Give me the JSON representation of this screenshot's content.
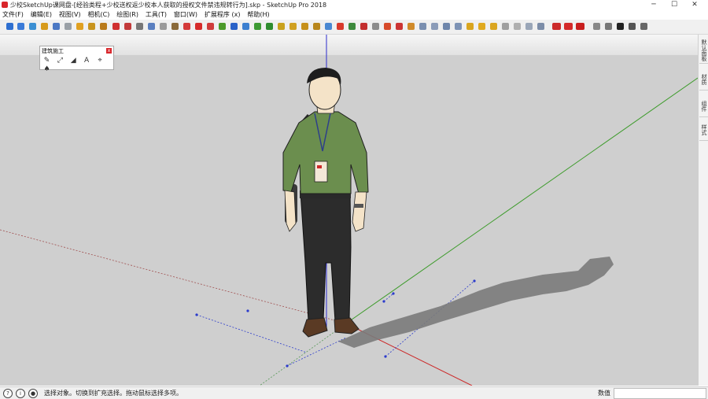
{
  "titlebar": {
    "title": "少校SketchUp课网盘-[经验类程+少校送权返少校本人获取的授权文件禁违规转行为].skp - SketchUp Pro 2018",
    "minimize": "─",
    "maximize": "☐",
    "close": "✕"
  },
  "menu": [
    "文件(F)",
    "编辑(E)",
    "视图(V)",
    "相机(C)",
    "绘图(R)",
    "工具(T)",
    "窗口(W)",
    "扩展程序 (x)",
    "帮助(H)"
  ],
  "floating_toolbar": {
    "title": "建筑施工",
    "close": "x"
  },
  "tray_tabs": [
    "默认面板",
    "材质",
    "组件",
    "样式"
  ],
  "statusbar": {
    "hint": "选择对象。切换到扩充选择。拖动鼠标选择多项。",
    "measurements_label": "数值",
    "measurements_value": ""
  },
  "colors": {
    "x_axis": "#cc2a2a",
    "y_axis": "#3c9b2a",
    "z_axis": "#2b2bcc",
    "background": "#cfcfcf",
    "shirt": "#6b8e4e",
    "pants": "#2a2a2a",
    "shadow": "#7a7a7a"
  }
}
